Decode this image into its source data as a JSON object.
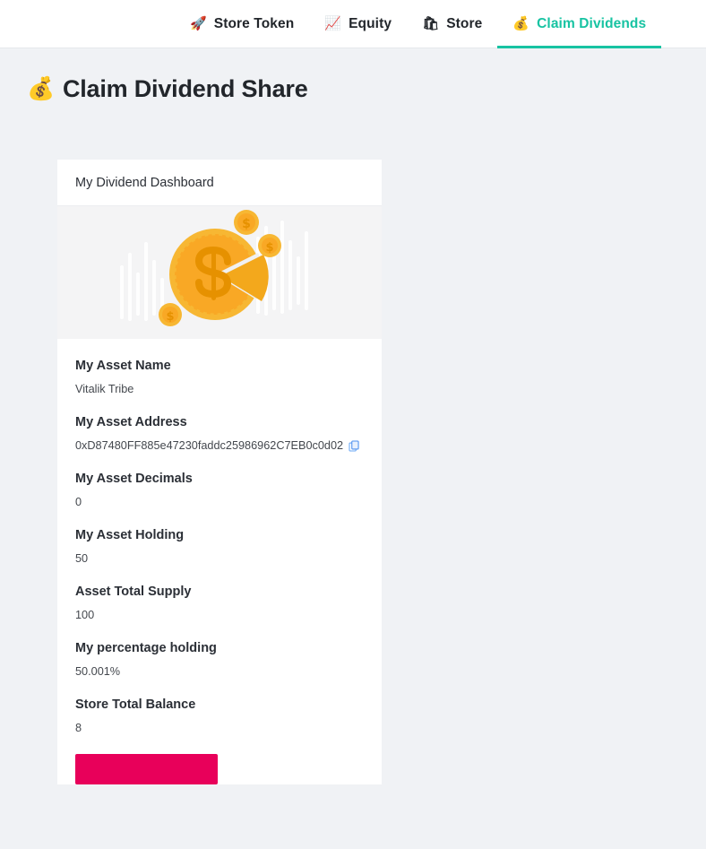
{
  "nav": {
    "tabs": [
      {
        "label": "Store Token",
        "icon": "rocket-icon",
        "emoji": "🚀",
        "active": false
      },
      {
        "label": "Equity",
        "icon": "chart-up-icon",
        "emoji": "📈",
        "active": false
      },
      {
        "label": "Store",
        "icon": "shopping-bag-icon",
        "emoji": "🛍",
        "active": false
      },
      {
        "label": "Claim Dividends",
        "icon": "money-bag-icon",
        "emoji": "💰",
        "active": true
      }
    ]
  },
  "page": {
    "title": "Claim Dividend Share",
    "title_emoji": "💰"
  },
  "card": {
    "header": "My Dividend Dashboard",
    "media_alt": "gold-coin-pie-chart-illustration",
    "fields": [
      {
        "label": "My Asset Name",
        "value": "Vitalik Tribe"
      },
      {
        "label": "My Asset Address",
        "value": "0xD87480FF885e47230faddc25986962C7EB0c0d02",
        "copyable": true
      },
      {
        "label": "My Asset Decimals",
        "value": "0"
      },
      {
        "label": "My Asset Holding",
        "value": "50"
      },
      {
        "label": "Asset Total Supply",
        "value": "100"
      },
      {
        "label": "My percentage holding",
        "value": "50.001%"
      },
      {
        "label": "Store Total Balance",
        "value": "8"
      }
    ],
    "claim_button_label": ""
  },
  "colors": {
    "accent_teal": "#17c3a2",
    "button_crimson": "#e8005a",
    "copy_icon_blue": "#4d8ff0",
    "page_background": "#f0f2f5",
    "coin_gold": "#f5a623"
  }
}
